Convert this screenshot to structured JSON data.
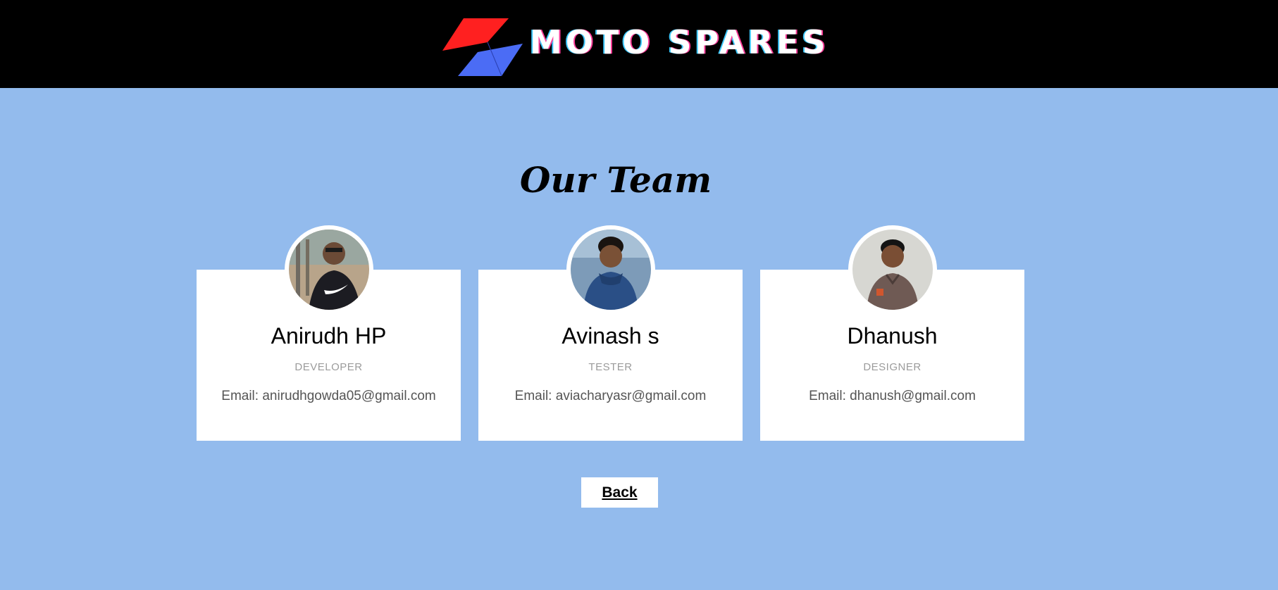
{
  "header": {
    "brand_name": "MOTO SPARES",
    "logo_icon": "moto-spares-logo-icon",
    "colors": {
      "background": "#000000",
      "logo_red": "#ff2020",
      "logo_blue": "#4b6cf5"
    }
  },
  "page": {
    "title": "Our Team",
    "background": "#93bbed"
  },
  "team": [
    {
      "name": "Anirudh HP",
      "role": "DEVELOPER",
      "email_label": "Email:",
      "email": "anirudhgowda05@gmail.com",
      "avatar_icon": "person-photo"
    },
    {
      "name": "Avinash s",
      "role": "TESTER",
      "email_label": "Email:",
      "email": "aviacharyasr@gmail.com",
      "avatar_icon": "person-photo"
    },
    {
      "name": "Dhanush",
      "role": "DESIGNER",
      "email_label": "Email:",
      "email": "dhanush@gmail.com",
      "avatar_icon": "person-photo"
    }
  ],
  "actions": {
    "back_label": "Back"
  }
}
